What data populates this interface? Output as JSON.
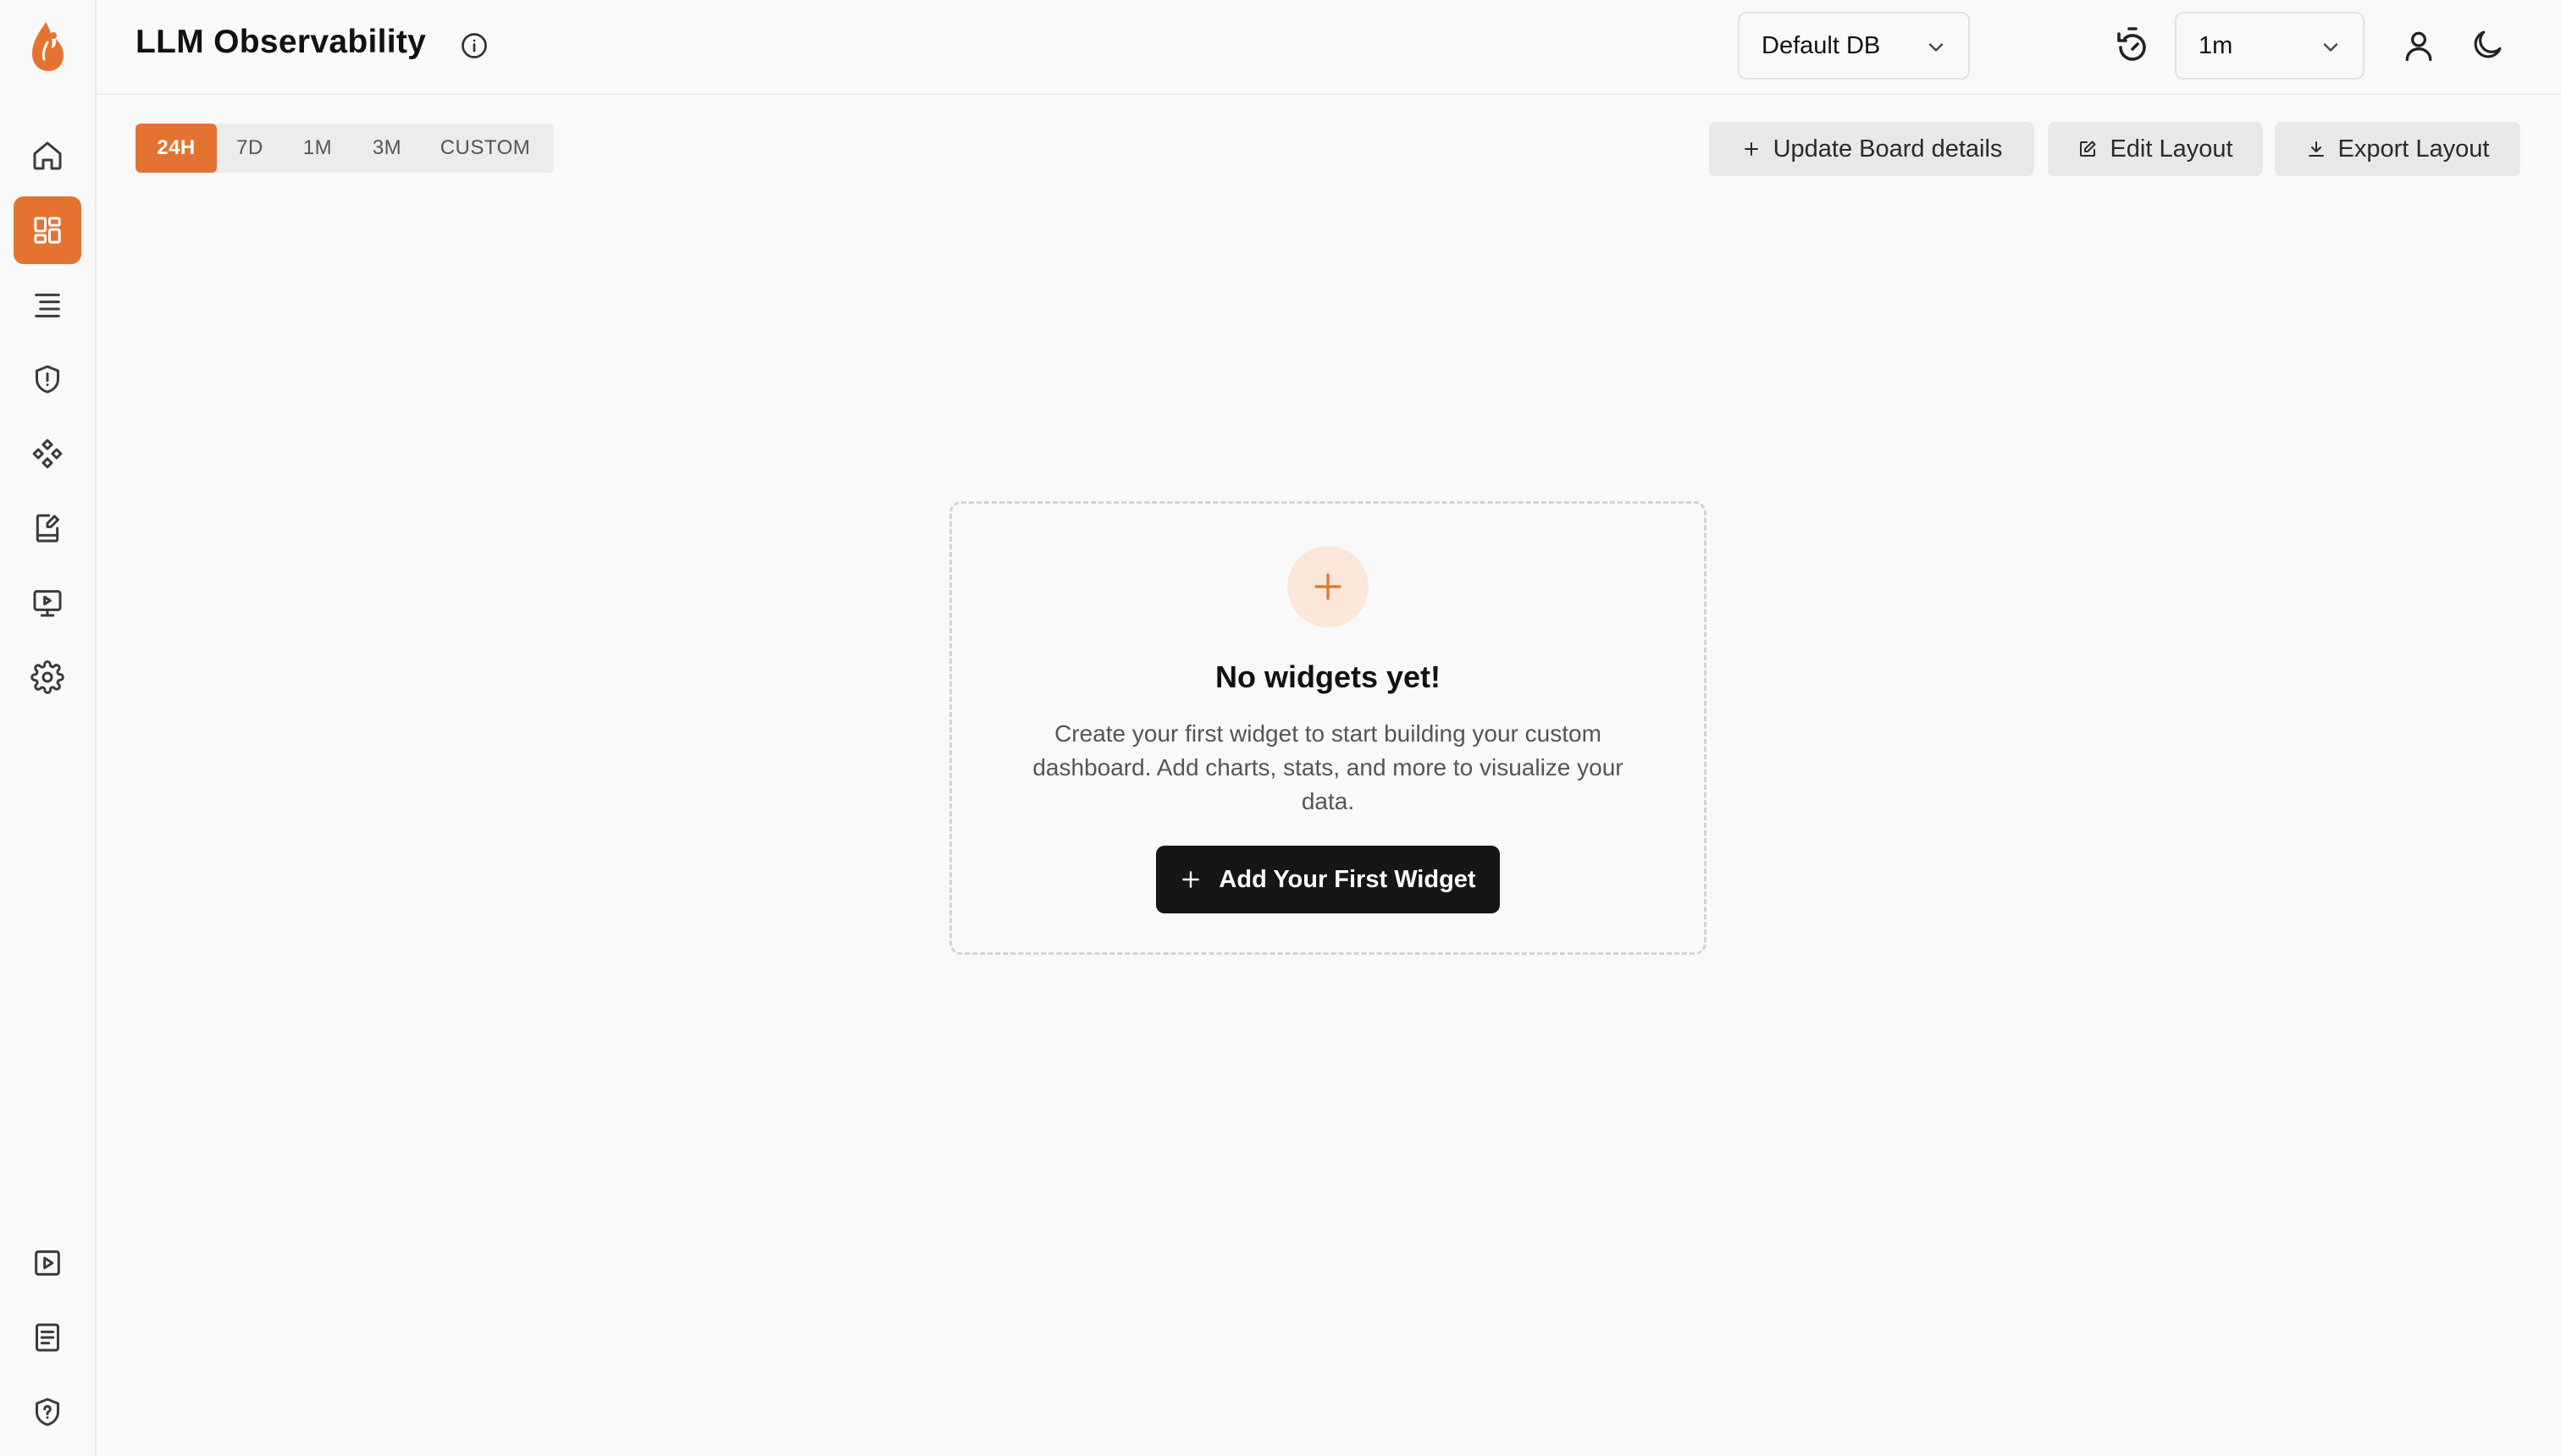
{
  "app": {
    "title": "LLM Observability",
    "accent_color": "#e47332"
  },
  "sidebar": {
    "top_items": [
      {
        "name": "home",
        "icon": "home-icon",
        "active": false
      },
      {
        "name": "dashboards",
        "icon": "dashboard-grid-icon",
        "active": true
      },
      {
        "name": "requests",
        "icon": "list-icon",
        "active": false
      },
      {
        "name": "guardrails",
        "icon": "shield-alert-icon",
        "active": false
      },
      {
        "name": "prompts",
        "icon": "components-icon",
        "active": false
      },
      {
        "name": "evaluations",
        "icon": "notebook-edit-icon",
        "active": false
      },
      {
        "name": "vault",
        "icon": "monitor-play-icon",
        "active": false
      },
      {
        "name": "settings",
        "icon": "gear-icon",
        "active": false
      }
    ],
    "bottom_items": [
      {
        "name": "demo",
        "icon": "play-square-icon"
      },
      {
        "name": "docs",
        "icon": "document-icon"
      },
      {
        "name": "help",
        "icon": "shield-help-icon"
      }
    ]
  },
  "header": {
    "db_select": {
      "value": "Default DB"
    },
    "refresh_interval": {
      "value": "1m"
    }
  },
  "time_range": {
    "tabs": [
      "24H",
      "7D",
      "1M",
      "3M",
      "CUSTOM"
    ],
    "selected": "24H"
  },
  "toolbar": {
    "update_label": "Update Board details",
    "edit_label": "Edit Layout",
    "export_label": "Export Layout"
  },
  "empty_state": {
    "title": "No widgets yet!",
    "description": "Create your first widget to start building your custom dashboard. Add charts, stats, and more to visualize your data.",
    "button_label": "Add Your First Widget"
  }
}
